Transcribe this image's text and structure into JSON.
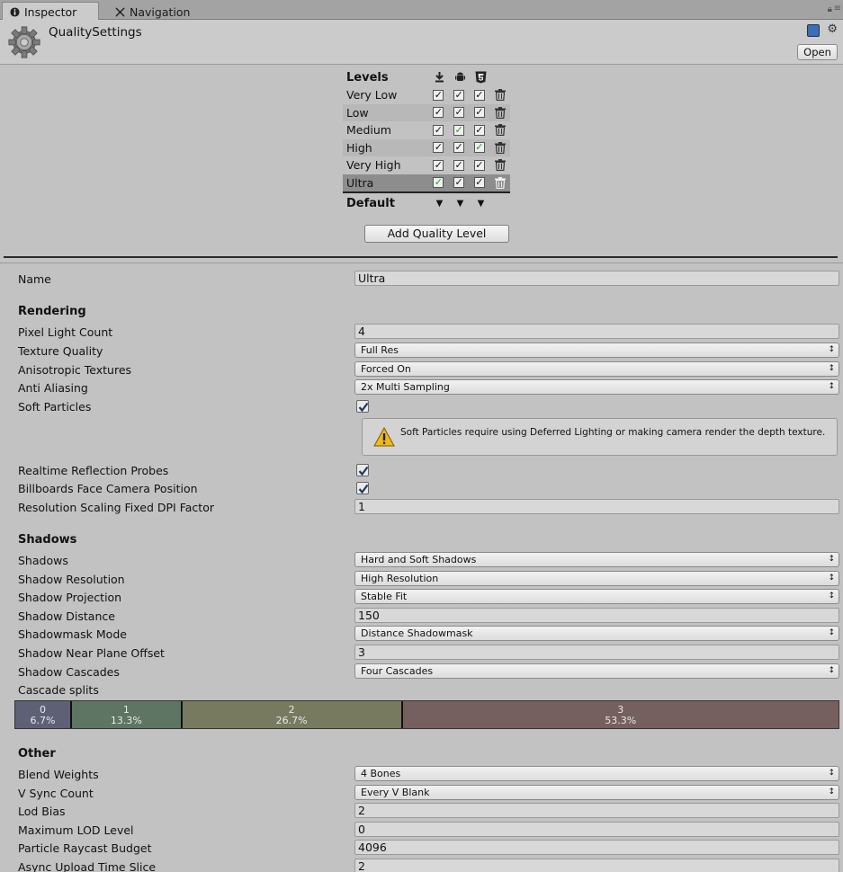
{
  "tabs": [
    {
      "label": "Inspector",
      "icon": "info-icon"
    },
    {
      "label": "Navigation",
      "icon": "navigation-icon"
    }
  ],
  "header": {
    "title": "QualitySettings",
    "open_label": "Open"
  },
  "levels": {
    "heading": "Levels",
    "platforms": [
      "download-icon",
      "android-icon",
      "html5-icon"
    ],
    "rows": [
      {
        "name": "Very Low",
        "green": [
          false,
          false,
          false
        ]
      },
      {
        "name": "Low",
        "green": [
          false,
          false,
          false
        ]
      },
      {
        "name": "Medium",
        "green": [
          false,
          true,
          false
        ]
      },
      {
        "name": "High",
        "green": [
          false,
          false,
          true
        ]
      },
      {
        "name": "Very High",
        "green": [
          false,
          false,
          false
        ]
      },
      {
        "name": "Ultra",
        "green": [
          true,
          false,
          false
        ]
      }
    ],
    "default_label": "Default",
    "add_button": "Add Quality Level"
  },
  "props": {
    "name_label": "Name",
    "name_value": "Ultra",
    "rendering": {
      "heading": "Rendering",
      "pixel_light_count_label": "Pixel Light Count",
      "pixel_light_count": "4",
      "texture_quality_label": "Texture Quality",
      "texture_quality": "Full Res",
      "anisotropic_label": "Anisotropic Textures",
      "anisotropic": "Forced On",
      "anti_aliasing_label": "Anti Aliasing",
      "anti_aliasing": "2x Multi Sampling",
      "soft_particles_label": "Soft Particles",
      "help_text": "Soft Particles require using Deferred Lighting or making camera render the depth texture.",
      "realtime_reflection_label": "Realtime Reflection Probes",
      "billboards_label": "Billboards Face Camera Position",
      "dpi_factor_label": "Resolution Scaling Fixed DPI Factor",
      "dpi_factor": "1"
    },
    "shadows": {
      "heading": "Shadows",
      "shadows_label": "Shadows",
      "shadows": "Hard and Soft Shadows",
      "resolution_label": "Shadow Resolution",
      "resolution": "High Resolution",
      "projection_label": "Shadow Projection",
      "projection": "Stable Fit",
      "distance_label": "Shadow Distance",
      "distance": "150",
      "shadowmask_label": "Shadowmask Mode",
      "shadowmask": "Distance Shadowmask",
      "near_plane_label": "Shadow Near Plane Offset",
      "near_plane": "3",
      "cascades_label": "Shadow Cascades",
      "cascades": "Four Cascades",
      "splits_label": "Cascade splits"
    },
    "cascade_splits": [
      {
        "index": "0",
        "pct": "6.7%",
        "frac": 0.067,
        "color": "#5e6076"
      },
      {
        "index": "1",
        "pct": "13.3%",
        "frac": 0.133,
        "color": "#5d7562"
      },
      {
        "index": "2",
        "pct": "26.7%",
        "frac": 0.267,
        "color": "#777a5e"
      },
      {
        "index": "3",
        "pct": "53.3%",
        "frac": 0.533,
        "color": "#765f5f"
      }
    ],
    "other": {
      "heading": "Other",
      "blend_weights_label": "Blend Weights",
      "blend_weights": "4 Bones",
      "vsync_label": "V Sync Count",
      "vsync": "Every V Blank",
      "lod_bias_label": "Lod Bias",
      "lod_bias": "2",
      "max_lod_label": "Maximum LOD Level",
      "max_lod": "0",
      "raycast_label": "Particle Raycast Budget",
      "raycast": "4096",
      "async_label": "Async Upload Time Slice",
      "async": "2"
    }
  }
}
